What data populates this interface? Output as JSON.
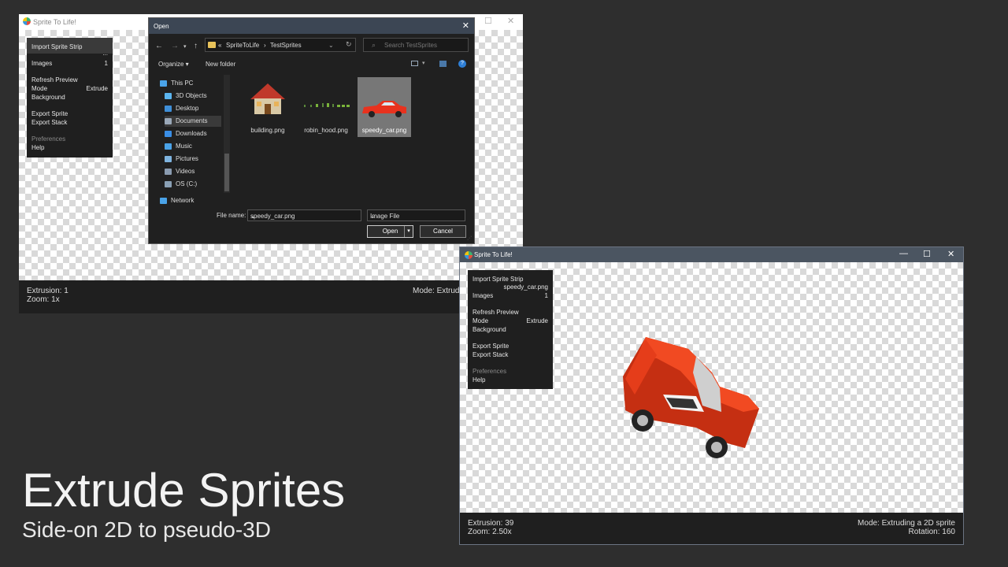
{
  "headline": "Extrude Sprites",
  "subheadline": "Side-on 2D to pseudo-3D",
  "window1": {
    "title": "Sprite To Life!",
    "menu": {
      "import_sprite_strip": "Import Sprite Strip",
      "import_ellipsis": "...",
      "images_label": "Images",
      "images_value": "1",
      "refresh_preview": "Refresh Preview",
      "mode_label": "Mode",
      "mode_value": "Extrude",
      "background_label": "Background",
      "export_sprite": "Export Sprite",
      "export_stack": "Export Stack",
      "preferences": "Preferences",
      "help": "Help"
    },
    "status": {
      "extrusion": "Extrusion: 1",
      "zoom": "Zoom: 1x",
      "mode": "Mode: Extrud"
    }
  },
  "open_dialog": {
    "title": "Open",
    "address": {
      "overflow": "«",
      "crumbs": [
        "SpriteToLife",
        "TestSprites"
      ],
      "separator": "›"
    },
    "search_placeholder": "Search TestSprites",
    "toolbar": {
      "organize": "Organize ▾",
      "new_folder": "New folder"
    },
    "nav_items": [
      {
        "label": "This PC",
        "icon": "computer-icon",
        "color": "#4aa3e8"
      },
      {
        "label": "3D Objects",
        "icon": "cube-icon",
        "color": "#5bb5f0"
      },
      {
        "label": "Desktop",
        "icon": "desktop-icon",
        "color": "#3f8fd8"
      },
      {
        "label": "Documents",
        "icon": "document-icon",
        "color": "#9aa8b8"
      },
      {
        "label": "Downloads",
        "icon": "download-icon",
        "color": "#3a8ee6"
      },
      {
        "label": "Music",
        "icon": "music-icon",
        "color": "#4aa3e8"
      },
      {
        "label": "Pictures",
        "icon": "pictures-icon",
        "color": "#7fb4e0"
      },
      {
        "label": "Videos",
        "icon": "videos-icon",
        "color": "#8a9bb0"
      },
      {
        "label": "OS (C:)",
        "icon": "drive-icon",
        "color": "#8aa0b5"
      },
      {
        "label": "Network",
        "icon": "network-icon",
        "color": "#4aa3e8"
      }
    ],
    "files": [
      {
        "name": "building.png"
      },
      {
        "name": "robin_hood.png"
      },
      {
        "name": "speedy_car.png"
      }
    ],
    "file_name_label": "File name:",
    "file_name_value": "speedy_car.png",
    "file_type": "Image File",
    "open_button": "Open",
    "cancel_button": "Cancel"
  },
  "window2": {
    "title": "Sprite To Life!",
    "menu": {
      "import_sprite_strip": "Import Sprite Strip",
      "import_file": "speedy_car.png",
      "images_label": "Images",
      "images_value": "1",
      "refresh_preview": "Refresh Preview",
      "mode_label": "Mode",
      "mode_value": "Extrude",
      "background_label": "Background",
      "export_sprite": "Export Sprite",
      "export_stack": "Export Stack",
      "preferences": "Preferences",
      "help": "Help"
    },
    "status": {
      "extrusion": "Extrusion: 39",
      "zoom": "Zoom: 2.50x",
      "mode": "Mode: Extruding a 2D sprite",
      "rotation": "Rotation: 160"
    }
  },
  "colors": {
    "background": "#2e2e2e",
    "panel": "#1f1f1f",
    "dialog_title": "#3c4654",
    "car_red": "#f03c1e"
  }
}
